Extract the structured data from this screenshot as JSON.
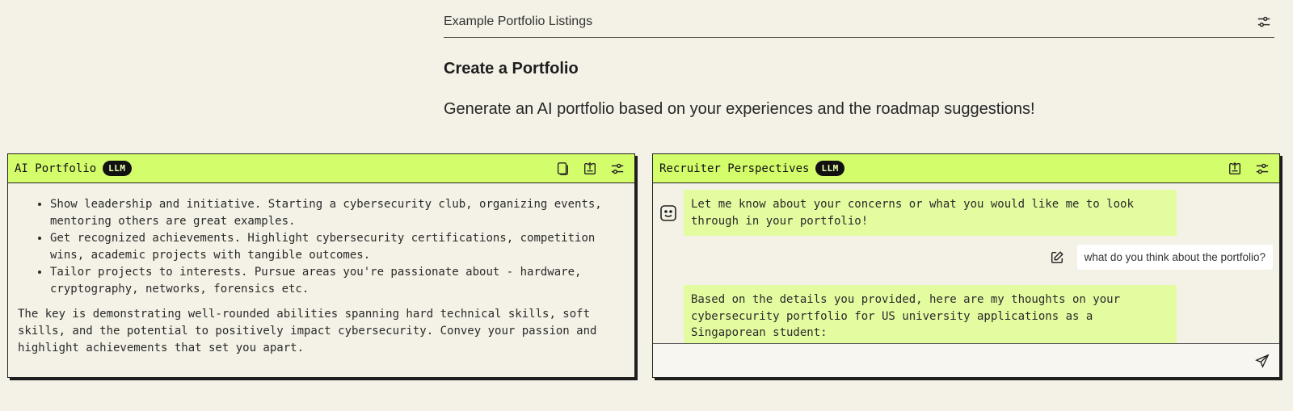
{
  "header": {
    "listings_label": "Example Portfolio Listings",
    "title": "Create a Portfolio",
    "subtitle": "Generate an AI portfolio based on your experiences and the roadmap suggestions!"
  },
  "portfolio_panel": {
    "title": "AI Portfolio",
    "badge": "LLM",
    "bullets": [
      "Show leadership and initiative. Starting a cybersecurity club, organizing events, mentoring others are great examples.",
      "Get recognized achievements. Highlight cybersecurity certifications, competition wins, academic projects with tangible outcomes.",
      "Tailor projects to interests. Pursue areas you're passionate about - hardware, cryptography, networks, forensics etc."
    ],
    "summary": "The key is demonstrating well-rounded abilities spanning hard technical skills, soft skills, and the potential to positively impact cybersecurity. Convey your passion and highlight achievements that set you apart."
  },
  "recruiter_panel": {
    "title": "Recruiter Perspectives",
    "badge": "LLM",
    "messages": [
      {
        "role": "bot",
        "text": "Let me know about your concerns or what you would like me to look through in your portfolio!"
      },
      {
        "role": "user",
        "text": "what do you think about the portfolio?"
      },
      {
        "role": "bot",
        "text": "Based on the details you provided, here are my thoughts on your cybersecurity portfolio for US university applications as a Singaporean student:"
      }
    ],
    "input": {
      "value": "",
      "placeholder": ""
    }
  },
  "icons": {
    "settings": "sliders-icon",
    "copy": "copy-icon",
    "export": "export-icon",
    "avatar": "smiley-bot-icon",
    "edit": "edit-icon",
    "send": "send-icon"
  },
  "colors": {
    "background": "#f4f1e6",
    "accent": "#d4fd6c",
    "bot_bubble": "#e3fca0",
    "badge": "#111111"
  }
}
